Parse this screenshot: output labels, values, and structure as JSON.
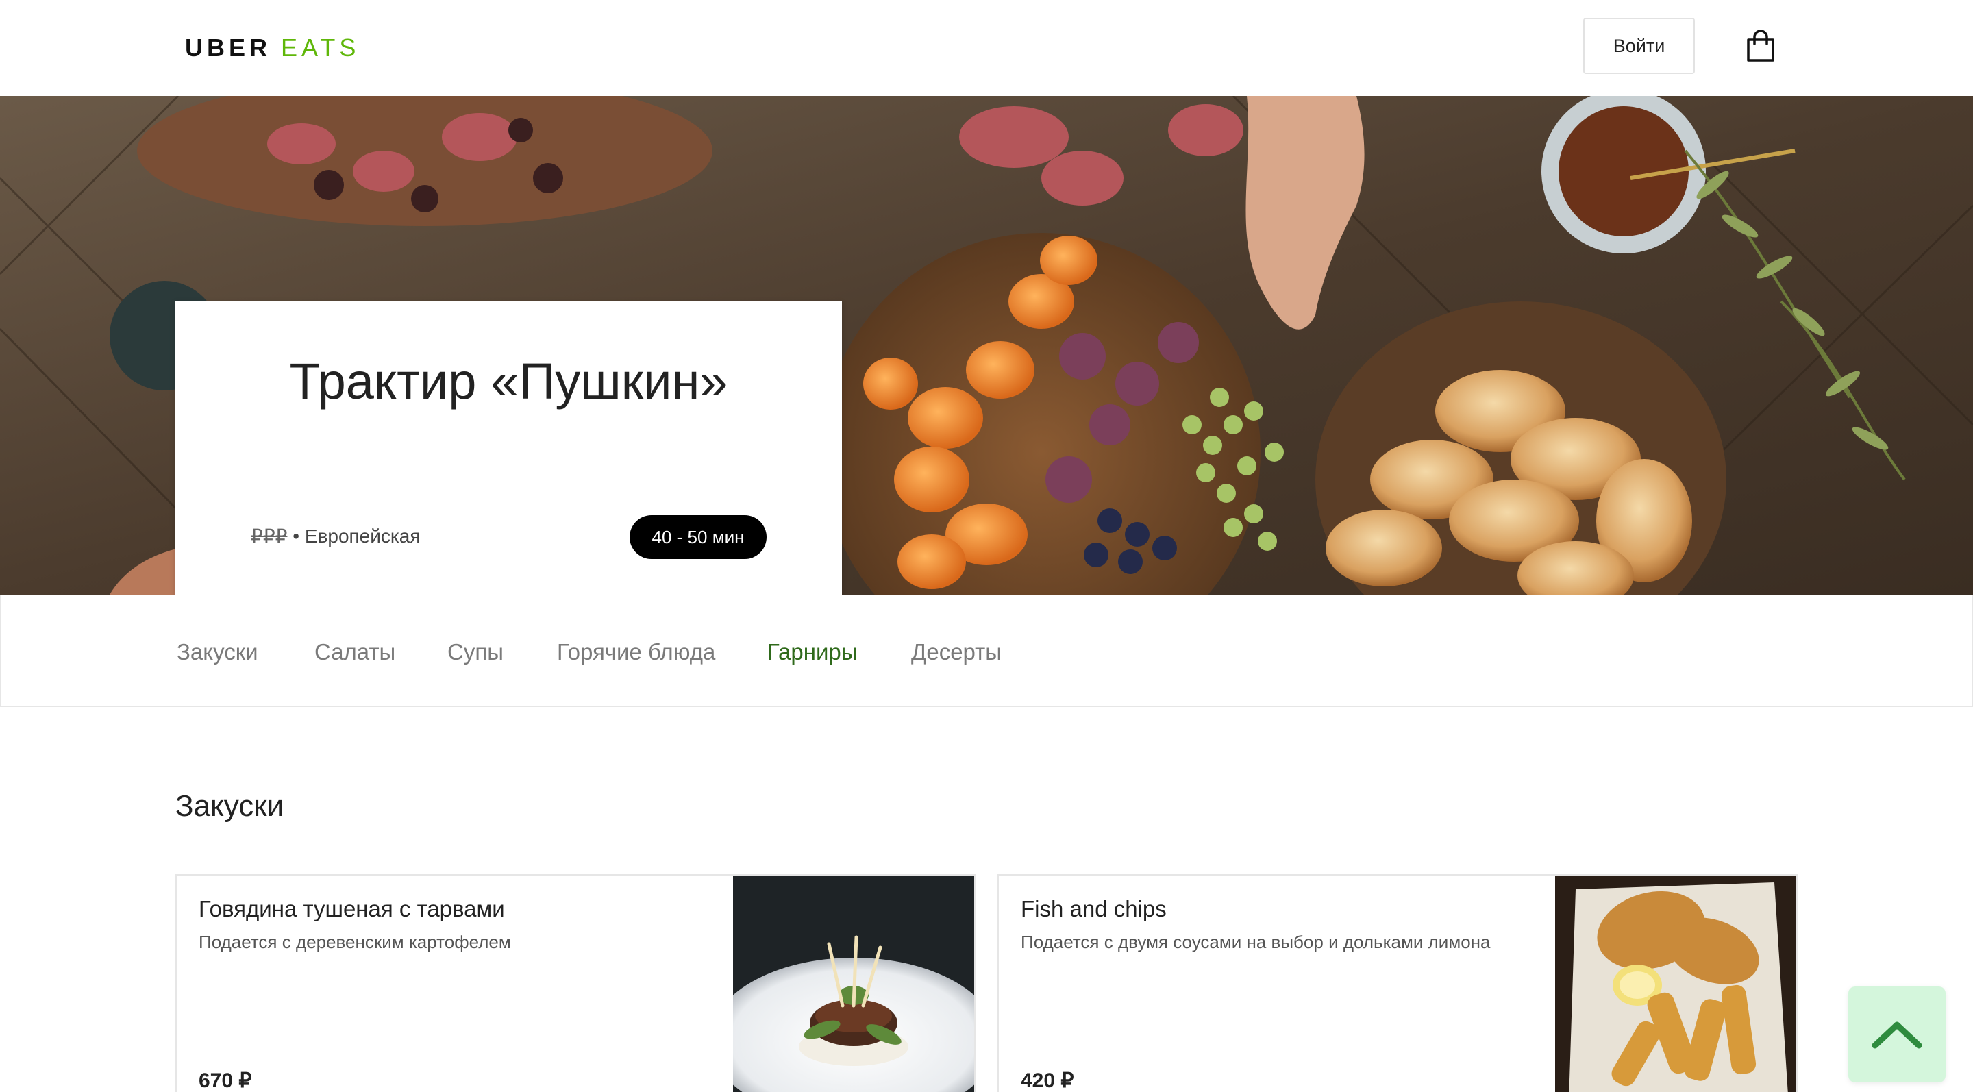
{
  "header": {
    "logo_primary": "UBER",
    "logo_secondary": "EATS",
    "login_label": "Войти",
    "cart_icon": "shopping-bag-icon"
  },
  "restaurant": {
    "name": "Трактир «Пушкин»",
    "price_level": "₽₽₽",
    "separator": "•",
    "cuisine": "Европейская",
    "delivery_time": "40 - 50 мин"
  },
  "categories": [
    {
      "label": "Закуски",
      "active": false
    },
    {
      "label": "Салаты",
      "active": false
    },
    {
      "label": "Супы",
      "active": false
    },
    {
      "label": "Горячие блюда",
      "active": false
    },
    {
      "label": "Гарниры",
      "active": true
    },
    {
      "label": "Десерты",
      "active": false
    }
  ],
  "section": {
    "title": "Закуски",
    "dishes": [
      {
        "name": "Говядина тушеная с тарвами",
        "description": "Подается с деревенским картофелем",
        "price": "670 ₽"
      },
      {
        "name": "Fish and chips",
        "description": "Подается с двумя соусами на выбор и дольками лимона",
        "price": "420 ₽"
      }
    ]
  },
  "scroll_top_icon": "chevron-up-icon",
  "colors": {
    "brand_green": "#5fb709",
    "active_category": "#2f6a1b",
    "scroll_button_bg": "#d4f6dc",
    "pill_bg": "#000000"
  }
}
